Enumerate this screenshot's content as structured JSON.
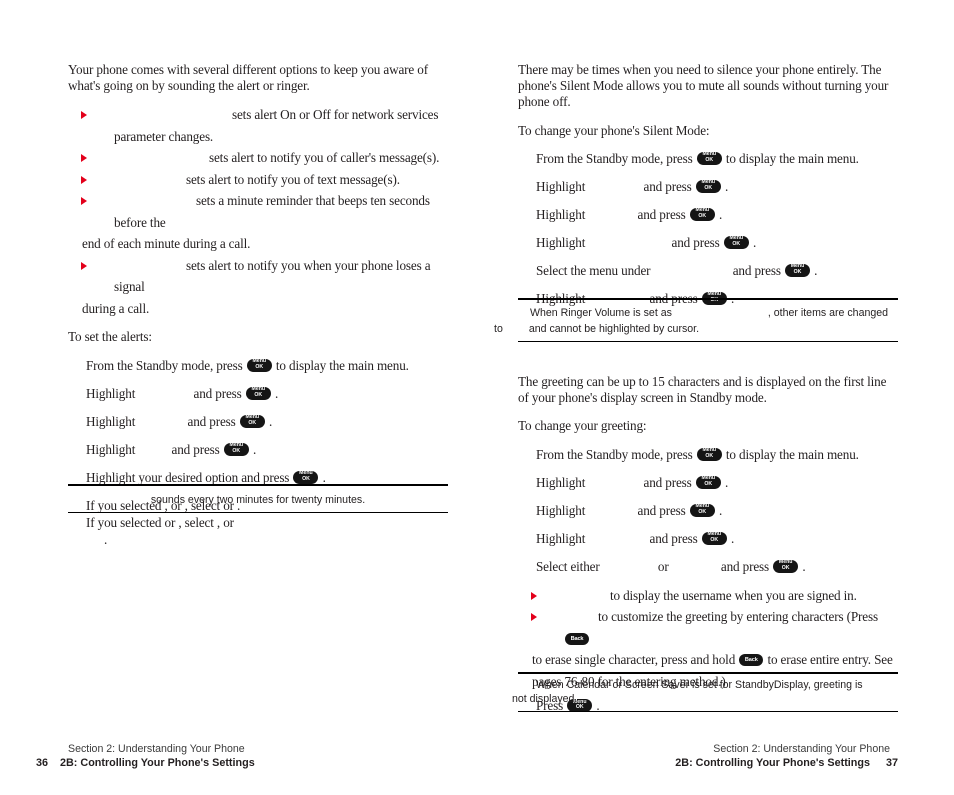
{
  "document": {
    "type": "phone-user-manual-spread",
    "background": "#ffffff",
    "bullet_color": "#e3001b",
    "text_color": "#231f20"
  },
  "left_page": {
    "intro": "Your phone comes with several different options to keep you aware of what's going on by sounding the alert or ringer.",
    "bullets": [
      {
        "text": "sets alert On or Off for network services parameter changes."
      },
      {
        "text": "sets alert to notify you of caller's message(s)."
      },
      {
        "text": "sets alert to notify you of text message(s)."
      },
      {
        "text": "sets a minute reminder that beeps ten seconds before the",
        "cont": "end of each minute during a call."
      },
      {
        "text": "sets alert to notify you when your phone loses a signal",
        "cont": "during a call."
      }
    ],
    "procedure_heading": "To set the alerts:",
    "steps": [
      {
        "pre": "From the Standby mode, press",
        "key": "menu-ok",
        "post": "to display the main menu."
      },
      {
        "pre": "Highlight",
        "mid": "and press",
        "key": "menu-ok",
        "post": "."
      },
      {
        "pre": "Highlight",
        "mid": "and press",
        "key": "menu-ok",
        "post": "."
      },
      {
        "pre": "Highlight",
        "mid": "and press",
        "key": "menu-ok",
        "post": "."
      },
      {
        "pre": "Highlight your desired option and press",
        "key": "menu-ok",
        "post": "."
      }
    ],
    "conditional_lines": [
      "If you selected                    ,                           or                           , select        or      .",
      "If you selected                          or                      , select            ,                         or",
      "."
    ],
    "note": "sounds every two minutes for twenty minutes.",
    "footer": {
      "section": "Section 2: Understanding Your Phone",
      "chapter": "2B: Controlling Your Phone's Settings",
      "page_number": "36"
    }
  },
  "right_page": {
    "silent_mode": {
      "intro": "There may be times when you need to silence your phone entirely. The phone's Silent Mode allows you to mute all sounds without turning your phone off.",
      "procedure_heading": "To change your phone's Silent Mode:",
      "steps": [
        {
          "pre": "From the Standby mode, press",
          "key": "menu-ok",
          "post": "to display the main menu."
        },
        {
          "pre": "Highlight",
          "mid": "and press",
          "key": "menu-ok",
          "post": "."
        },
        {
          "pre": "Highlight",
          "mid": "and press",
          "key": "menu-ok",
          "post": "."
        },
        {
          "pre": "Highlight",
          "mid": "and press",
          "key": "menu-ok",
          "post": "."
        },
        {
          "pre": "Select the menu under",
          "mid": "and press",
          "key": "menu-ok",
          "post": "."
        },
        {
          "pre": "Highlight",
          "mid": "and press",
          "key": "menu-ok",
          "post": "."
        }
      ],
      "note_line1_a": "When Ringer Volume is set as",
      "note_line1_b": ", other items are changed",
      "note_line2_a": "to",
      "note_line2_b": "and cannot be highlighted by cursor."
    },
    "greeting": {
      "intro": "The greeting can be up to 15 characters and is displayed on the first line of your phone's display screen in Standby mode.",
      "procedure_heading": "To change your greeting:",
      "steps": [
        {
          "pre": "From the Standby mode, press",
          "key": "menu-ok",
          "post": "to display the main menu."
        },
        {
          "pre": "Highlight",
          "mid": "and press",
          "key": "menu-ok",
          "post": "."
        },
        {
          "pre": "Highlight",
          "mid": "and press",
          "key": "menu-ok",
          "post": "."
        },
        {
          "pre": "Highlight",
          "mid": "and press",
          "key": "menu-ok",
          "post": "."
        },
        {
          "pre": "Select either",
          "mid": "or",
          "mid2": "and press",
          "key": "menu-ok",
          "post": "."
        }
      ],
      "bullets": [
        {
          "text": "to display the username when you are signed in."
        },
        {
          "text": "to customize the greeting by entering characters (Press",
          "after_key1": "to erase single character, press and hold",
          "after_key2": "to erase entire entry. See",
          "cont": "pages 76-80 for the entering method.)"
        }
      ],
      "final_step": {
        "pre": "Press",
        "key": "menu-ok",
        "post": "."
      },
      "note_line1": "When Calendar or Screen Saver is set for StandbyDisplay, greeting is",
      "note_line2": "not displayed."
    },
    "footer": {
      "section": "Section 2: Understanding Your Phone",
      "chapter": "2B: Controlling Your Phone's Settings",
      "page_number": "37"
    }
  },
  "keys": {
    "menu_ok_line1": "Menu",
    "menu_ok_line2": "OK",
    "back": "Back"
  }
}
